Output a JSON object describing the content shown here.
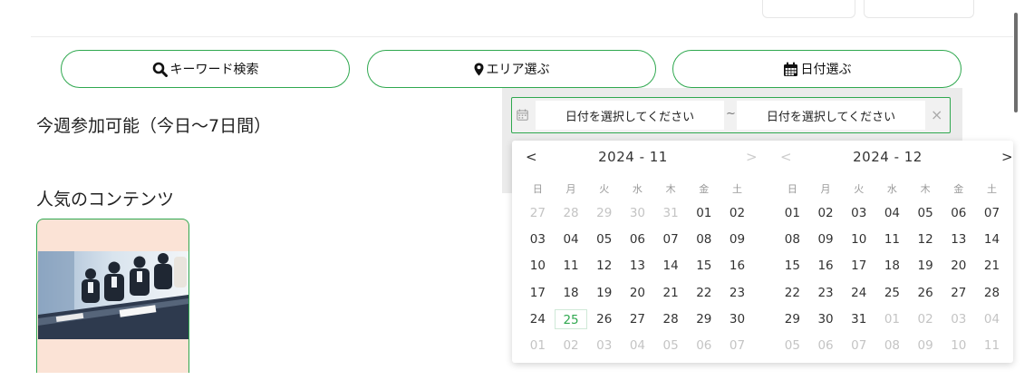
{
  "search_buttons": [
    {
      "label": "キーワード検索",
      "icon": "search-icon"
    },
    {
      "label": "エリア選ぶ",
      "icon": "map-pin-icon"
    },
    {
      "label": "日付選ぶ",
      "icon": "calendar-icon"
    }
  ],
  "sections": {
    "this_week": "今週参加可能（今日〜7日間）",
    "popular": "人気のコンテンツ"
  },
  "date_range": {
    "start_placeholder": "日付を選択してください",
    "separator": "~",
    "end_placeholder": "日付を選択してください",
    "clear": "×"
  },
  "calendar": {
    "prev": "<",
    "next": ">",
    "weekdays": [
      "日",
      "月",
      "火",
      "水",
      "木",
      "金",
      "土"
    ],
    "months": [
      {
        "title": "2024 - 11",
        "weeks": [
          [
            {
              "d": "27",
              "m": 1
            },
            {
              "d": "28",
              "m": 1
            },
            {
              "d": "29",
              "m": 1
            },
            {
              "d": "30",
              "m": 1
            },
            {
              "d": "31",
              "m": 1
            },
            {
              "d": "01"
            },
            {
              "d": "02"
            }
          ],
          [
            {
              "d": "03"
            },
            {
              "d": "04"
            },
            {
              "d": "05"
            },
            {
              "d": "06"
            },
            {
              "d": "07"
            },
            {
              "d": "08"
            },
            {
              "d": "09"
            }
          ],
          [
            {
              "d": "10"
            },
            {
              "d": "11"
            },
            {
              "d": "12"
            },
            {
              "d": "13"
            },
            {
              "d": "14"
            },
            {
              "d": "15"
            },
            {
              "d": "16"
            }
          ],
          [
            {
              "d": "17"
            },
            {
              "d": "18"
            },
            {
              "d": "19"
            },
            {
              "d": "20"
            },
            {
              "d": "21"
            },
            {
              "d": "22"
            },
            {
              "d": "23"
            }
          ],
          [
            {
              "d": "24"
            },
            {
              "d": "25",
              "today": 1
            },
            {
              "d": "26"
            },
            {
              "d": "27"
            },
            {
              "d": "28"
            },
            {
              "d": "29"
            },
            {
              "d": "30"
            }
          ],
          [
            {
              "d": "01",
              "m": 1
            },
            {
              "d": "02",
              "m": 1
            },
            {
              "d": "03",
              "m": 1
            },
            {
              "d": "04",
              "m": 1
            },
            {
              "d": "05",
              "m": 1
            },
            {
              "d": "06",
              "m": 1
            },
            {
              "d": "07",
              "m": 1
            }
          ]
        ]
      },
      {
        "title": "2024 - 12",
        "weeks": [
          [
            {
              "d": "01"
            },
            {
              "d": "02"
            },
            {
              "d": "03"
            },
            {
              "d": "04"
            },
            {
              "d": "05"
            },
            {
              "d": "06"
            },
            {
              "d": "07"
            }
          ],
          [
            {
              "d": "08"
            },
            {
              "d": "09"
            },
            {
              "d": "10"
            },
            {
              "d": "11"
            },
            {
              "d": "12"
            },
            {
              "d": "13"
            },
            {
              "d": "14"
            }
          ],
          [
            {
              "d": "15"
            },
            {
              "d": "16"
            },
            {
              "d": "17"
            },
            {
              "d": "18"
            },
            {
              "d": "19"
            },
            {
              "d": "20"
            },
            {
              "d": "21"
            }
          ],
          [
            {
              "d": "22"
            },
            {
              "d": "23"
            },
            {
              "d": "24"
            },
            {
              "d": "25"
            },
            {
              "d": "26"
            },
            {
              "d": "27"
            },
            {
              "d": "28"
            }
          ],
          [
            {
              "d": "29"
            },
            {
              "d": "30"
            },
            {
              "d": "31"
            },
            {
              "d": "01",
              "m": 1
            },
            {
              "d": "02",
              "m": 1
            },
            {
              "d": "03",
              "m": 1
            },
            {
              "d": "04",
              "m": 1
            }
          ],
          [
            {
              "d": "05",
              "m": 1
            },
            {
              "d": "06",
              "m": 1
            },
            {
              "d": "07",
              "m": 1
            },
            {
              "d": "08",
              "m": 1
            },
            {
              "d": "09",
              "m": 1
            },
            {
              "d": "10",
              "m": 1
            },
            {
              "d": "11",
              "m": 1
            }
          ]
        ]
      }
    ]
  },
  "colors": {
    "accent": "#2fa84f",
    "card_bg": "#fbe3d6",
    "muted_text": "#c4c4c4"
  }
}
